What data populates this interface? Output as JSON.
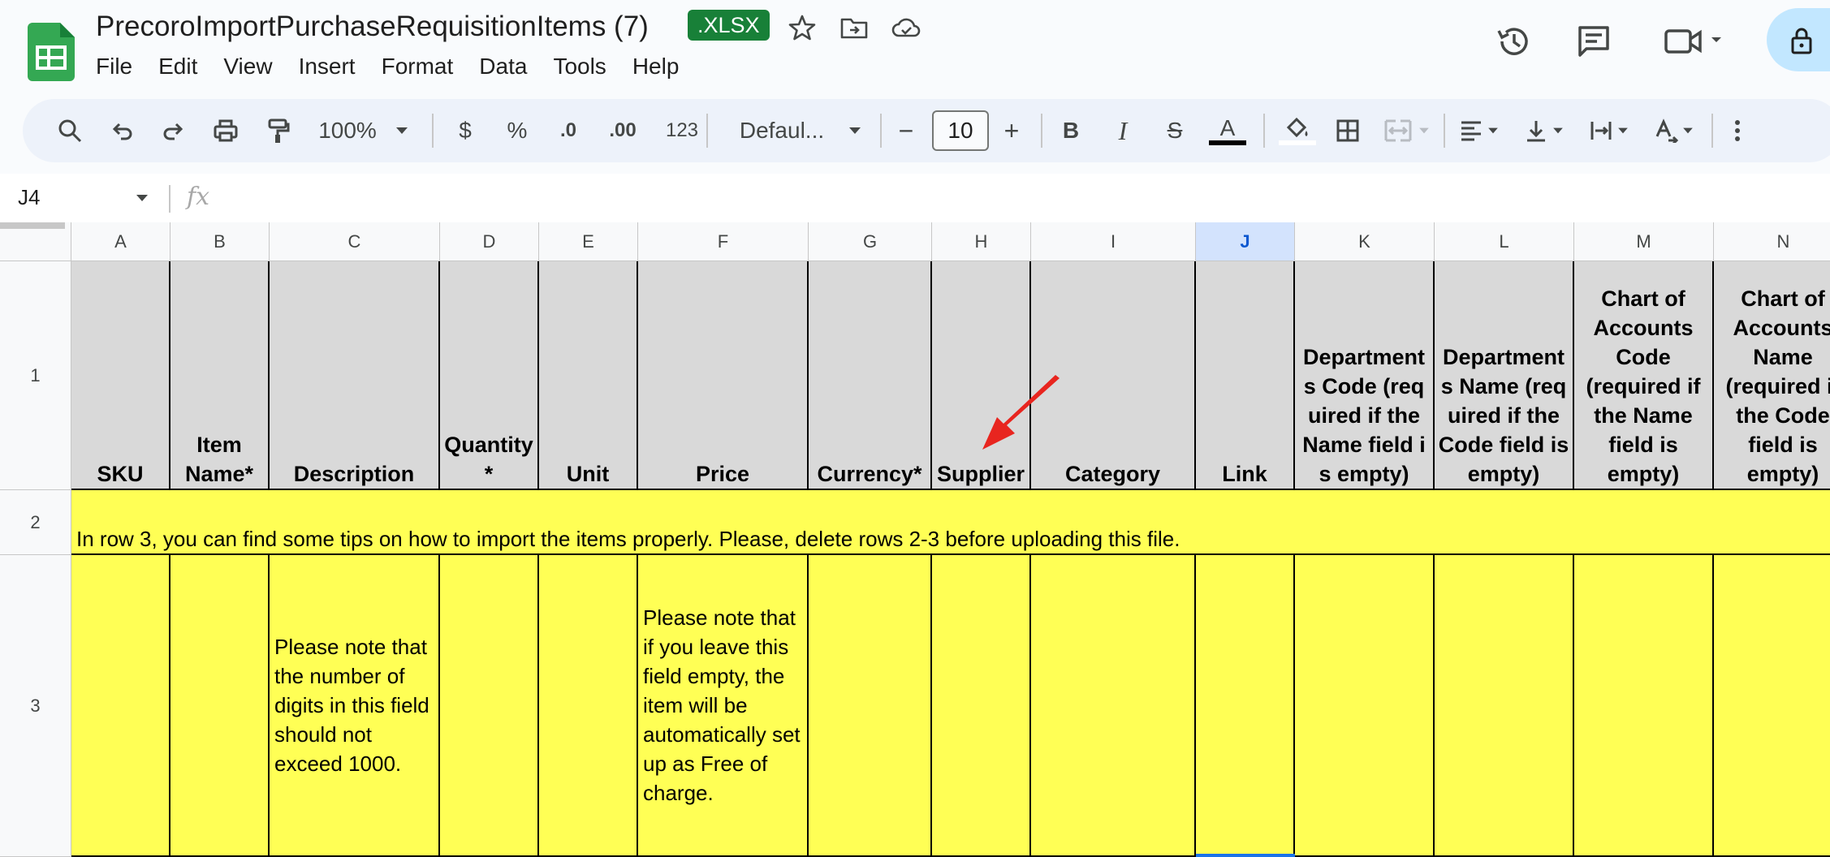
{
  "doc": {
    "title": "PrecoroImportPurchaseRequisitionItems (7)",
    "badge": ".XLSX"
  },
  "menu": [
    "File",
    "Edit",
    "View",
    "Insert",
    "Format",
    "Data",
    "Tools",
    "Help"
  ],
  "toolbar": {
    "zoom": "100%",
    "currency": "$",
    "percent": "%",
    "decrease_decimal": ".0",
    "increase_decimal": ".00",
    "number_format": "123",
    "font": "Defaul...",
    "font_size": "10",
    "minus": "−",
    "plus": "+",
    "bold": "B",
    "italic": "I",
    "strike": "S",
    "text_color": "A"
  },
  "formula_bar": {
    "cell_ref": "J4",
    "fx": "fx"
  },
  "columns": [
    "A",
    "B",
    "C",
    "D",
    "E",
    "F",
    "G",
    "H",
    "I",
    "J",
    "K",
    "L",
    "M",
    "N"
  ],
  "selected_column": "J",
  "rows": [
    "1",
    "2",
    "3"
  ],
  "header_row": [
    "SKU",
    "Item Name*",
    "Description",
    "Quantity *",
    "Unit",
    "Price",
    "Currency*",
    "Supplier",
    "Category",
    "Link",
    "Departments Code (required if the Name field is empty)",
    "Departments Name (required if the Code field is empty)",
    "Chart of Accounts Code (required if the Name field is empty)",
    "Chart of Accounts Name (required if the Code field is empty)"
  ],
  "row2_notice": "In row 3, you can find some tips on how to import the items properly. Please, delete rows 2-3 before uploading this file.",
  "row3": {
    "C": "Please note that the number of digits in this field should not exceed 1000.",
    "F": "Please note that if you leave this field empty, the item will be automatically set up as Free of charge."
  },
  "colors": {
    "header_fill": "#d9d9d9",
    "highlight_fill": "#ffff55",
    "badge": "#188038",
    "arrow": "#e8251f"
  }
}
